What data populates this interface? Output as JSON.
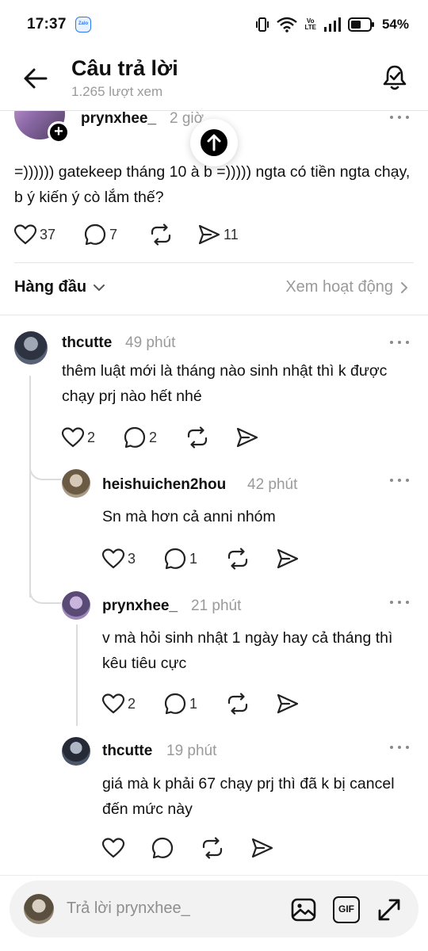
{
  "status_bar": {
    "time": "17:37",
    "zalo_label": "Zalo",
    "volte_top": "Vo",
    "volte_bottom": "LTE",
    "battery_percent": "54%",
    "battery_level": 0.54,
    "icons": [
      "zalo-icon",
      "vibrate-icon",
      "wifi-icon",
      "volte-icon",
      "signal-icon",
      "battery-icon"
    ]
  },
  "header": {
    "title": "Câu trả lời",
    "views": "1.265 lượt xem",
    "icons": [
      "back-arrow-icon",
      "bell-icon"
    ]
  },
  "post": {
    "username": "prynxhee_",
    "time": "2 giờ",
    "text": "=)))))) gatekeep tháng 10 à b =))))) ngta có tiền ngta chạy, b ý kiến ý cò lắm thế?",
    "likes": "37",
    "comments": "7",
    "shares": "11"
  },
  "sort": {
    "label": "Hàng đầu",
    "activity_label": "Xem hoạt động"
  },
  "comments": [
    {
      "username": "thcutte",
      "time": "49 phút",
      "text": "thêm luật mới là tháng nào sinh nhật thì k được chạy prj nào hết nhé",
      "likes": "2",
      "replies": "2"
    },
    {
      "username": "heishuichen2hou",
      "time": "42 phút",
      "text": "Sn mà hơn cả anni nhóm",
      "likes": "3",
      "replies": "1"
    },
    {
      "username": "prynxhee_",
      "time": "21 phút",
      "text": "v mà hỏi sinh nhật 1 ngày hay cả tháng thì kêu tiêu cực",
      "likes": "2",
      "replies": "1"
    },
    {
      "username": "thcutte",
      "time": "19 phút",
      "text": "giá mà k phải 67 chạy prj thì đã k bị cancel đến mức này",
      "likes": "",
      "replies": ""
    }
  ],
  "reply_bar": {
    "placeholder": "Trả lời prynxhee_",
    "gif_label": "GIF",
    "icons": [
      "image-icon",
      "gif-icon",
      "expand-icon"
    ]
  },
  "colors": {
    "text": "#101010",
    "muted": "#9a9a9a",
    "divider": "#e5e5e5",
    "input_bg": "#f2f2f2"
  }
}
